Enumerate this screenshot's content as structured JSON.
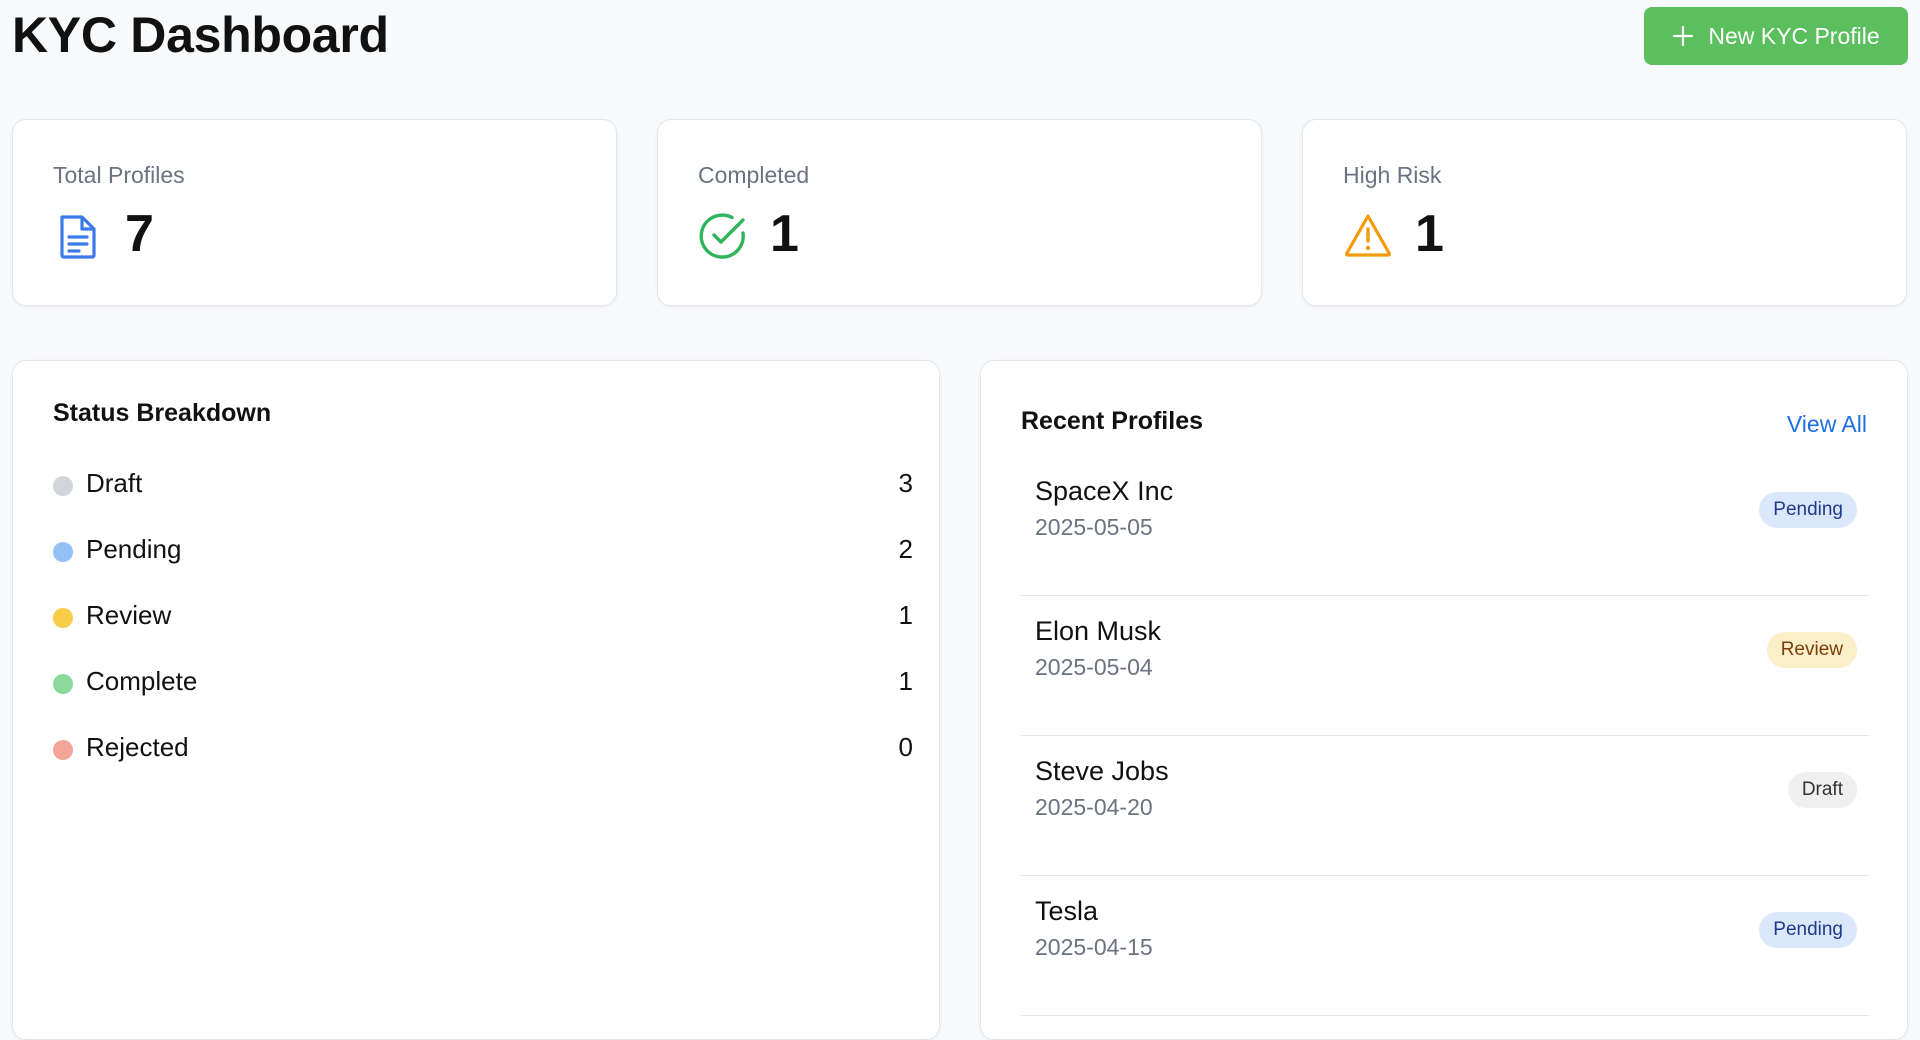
{
  "header": {
    "title": "KYC Dashboard",
    "new_button_label": "New KYC Profile"
  },
  "stats": [
    {
      "label": "Total Profiles",
      "value": "7",
      "icon": "document-icon",
      "color": "#3b7be9"
    },
    {
      "label": "Completed",
      "value": "1",
      "icon": "check-circle-icon",
      "color": "#2fb45a"
    },
    {
      "label": "High Risk",
      "value": "1",
      "icon": "warning-icon",
      "color": "#f29a0c"
    }
  ],
  "status_breakdown": {
    "title": "Status Breakdown",
    "items": [
      {
        "name": "Draft",
        "count": "3",
        "color": "#d1d5db"
      },
      {
        "name": "Pending",
        "count": "2",
        "color": "#93c0f5"
      },
      {
        "name": "Review",
        "count": "1",
        "color": "#f8cb48"
      },
      {
        "name": "Complete",
        "count": "1",
        "color": "#8ad99b"
      },
      {
        "name": "Rejected",
        "count": "0",
        "color": "#f4a597"
      }
    ]
  },
  "recent_profiles": {
    "title": "Recent Profiles",
    "view_all_label": "View All",
    "items": [
      {
        "name": "SpaceX Inc",
        "date": "2025-05-05",
        "status": "Pending"
      },
      {
        "name": "Elon Musk",
        "date": "2025-05-04",
        "status": "Review"
      },
      {
        "name": "Steve Jobs",
        "date": "2025-04-20",
        "status": "Draft"
      },
      {
        "name": "Tesla",
        "date": "2025-04-15",
        "status": "Pending"
      }
    ]
  }
}
